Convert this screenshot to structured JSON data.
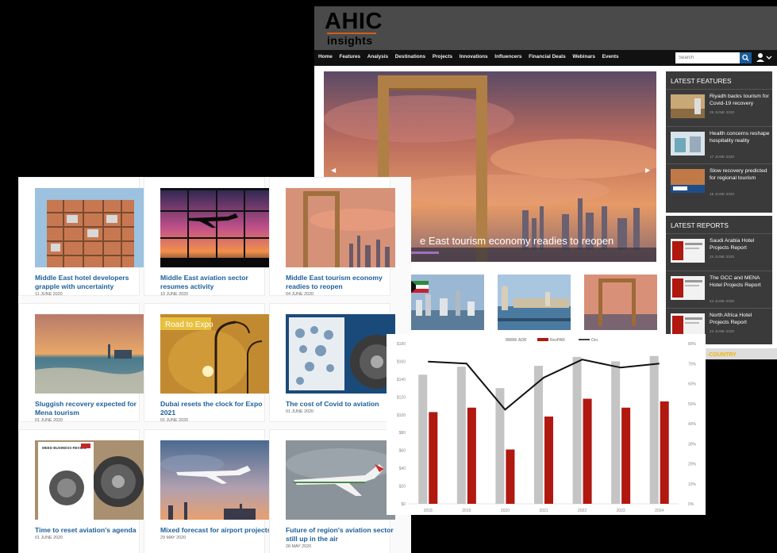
{
  "site": {
    "logo": "AHIC",
    "logo_sub": "insights",
    "nav": [
      "Home",
      "Features",
      "Analysis",
      "Destinations",
      "Projects",
      "Innovations",
      "Influencers",
      "Financial Deals",
      "Webinars",
      "Events"
    ],
    "search_placeholder": "Search",
    "hero_caption": "e East tourism economy readies to reopen",
    "latest_features_title": "LATEST FEATURES",
    "latest_features": [
      {
        "title": "Riyadh backs tourism for Covid-19 recovery",
        "date": "25 JUNE 2020"
      },
      {
        "title": "Health concerns reshape hospitality reality",
        "date": "17 JUNE 2020"
      },
      {
        "title": "Slow recovery predicted for regional tourism",
        "date": "16 JUNE 2020"
      }
    ],
    "latest_reports_title": "LATEST REPORTS",
    "latest_reports": [
      {
        "title": "Saudi Arabia Hotel Projects Report",
        "date": "24 JUNE 2020"
      },
      {
        "title": "The GCC and MENA Hotel Projects Report",
        "date": "24 JUNE 2020"
      },
      {
        "title": "North Africa Hotel Projects Report",
        "date": "24 JUNE 2020"
      }
    ],
    "banner_text": "-COUNTRY"
  },
  "grid": {
    "cards": [
      {
        "title": "Middle East hotel developers grapple with uncertainty",
        "date": "11 JUNE 2020"
      },
      {
        "title": "Middle East aviation sector resumes activity",
        "date": "10 JUNE 2020"
      },
      {
        "title": "Middle East tourism economy readies to reopen",
        "date": "04 JUNE 2020"
      },
      {
        "title": "Sluggish recovery expected for Mena tourism",
        "date": "01 JUNE 2020"
      },
      {
        "title": "Dubai resets the clock for Expo 2021",
        "date": "01 JUNE 2020"
      },
      {
        "title": "The cost of Covid to aviation",
        "date": "01 JUNE 2020"
      },
      {
        "title": "Time to reset aviation's agenda",
        "date": "01 JUNE 2020"
      },
      {
        "title": "Mixed forecast for airport projects",
        "date": "29 MAY 2020"
      },
      {
        "title": "Future of region's aviation sector still up in the air",
        "date": "28 MAY 2020"
      }
    ],
    "expo_badge": "Road to Expo",
    "magazine_label": "MEED BUSINESS REVIEW"
  },
  "chart_data": {
    "type": "bar",
    "categories": [
      "2018",
      "2019",
      "2020",
      "2021",
      "2022",
      "2023",
      "2024"
    ],
    "series": [
      {
        "name": "ADR",
        "kind": "bar",
        "axis": "left",
        "color": "#c4c4c4",
        "values": [
          145,
          154,
          130,
          155,
          165,
          160,
          166
        ]
      },
      {
        "name": "RevPAR",
        "kind": "bar",
        "axis": "left",
        "color": "#b01810",
        "values": [
          103,
          108,
          61,
          98,
          118,
          108,
          115
        ]
      },
      {
        "name": "Occ",
        "kind": "line",
        "axis": "right",
        "color": "#111111",
        "values": [
          71,
          70,
          47,
          63,
          72,
          68,
          70
        ]
      }
    ],
    "y_left": {
      "min": 0,
      "max": 180,
      "step": 20,
      "ticks": [
        "$0",
        "$20",
        "$40",
        "$60",
        "$80",
        "$100",
        "$120",
        "$140",
        "$160",
        "$180"
      ]
    },
    "y_right": {
      "min": 0,
      "max": 80,
      "step": 10,
      "ticks": [
        "0%",
        "10%",
        "20%",
        "30%",
        "40%",
        "50%",
        "60%",
        "70%",
        "80%"
      ]
    },
    "legend": "top",
    "grid": false
  }
}
